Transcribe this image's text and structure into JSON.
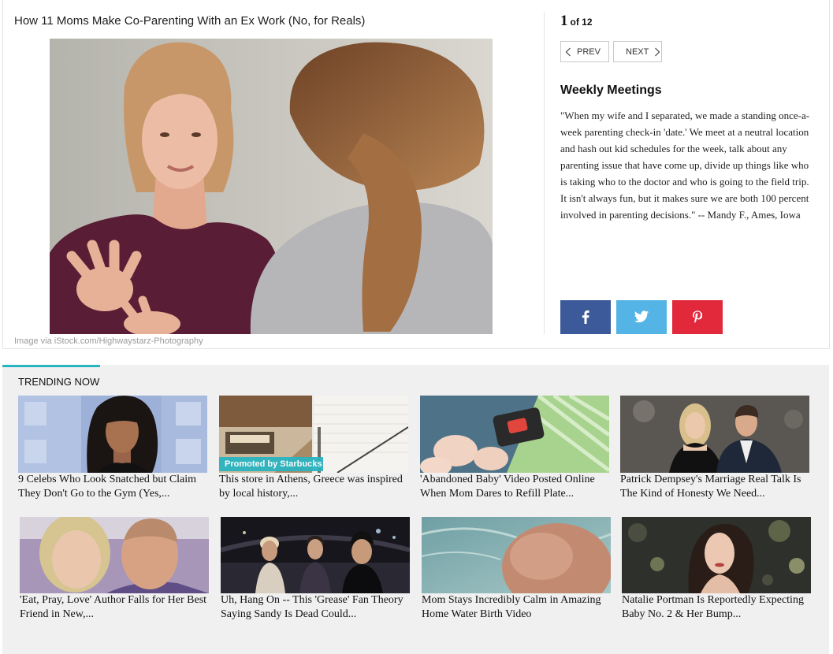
{
  "article": {
    "title": "How 11 Moms Make Co-Parenting With an Ex Work (No, for Reals)",
    "image_credit": "Image via iStock.com/Highwaystarz-Photography"
  },
  "slideshow": {
    "current": "1",
    "total_label": "of 12",
    "prev_label": "PREV",
    "prev_icon": "chevron-left-icon",
    "next_label": "NEXT",
    "next_icon": "chevron-right-icon",
    "slide_heading": "Weekly Meetings",
    "slide_body": "\"When my wife and I separated, we made a standing once-a-week parenting check-in 'date.' We meet at a neutral location and hash out kid schedules for the week, talk about any parenting issue that have come up, divide up things like who is taking who to the doctor and who is going to the field trip. It isn't always fun, but it makes sure we are both 100 percent involved in parenting decisions.\" -- Mandy F., Ames, Iowa"
  },
  "share": {
    "buttons": [
      {
        "icon": "facebook-icon",
        "color": "#3c5a99"
      },
      {
        "icon": "twitter-icon",
        "color": "#55b4e6"
      },
      {
        "icon": "pinterest-icon",
        "color": "#e2283b"
      }
    ]
  },
  "trending": {
    "heading": "TRENDING NOW",
    "accent_color": "#2ab4c1",
    "background_color": "#f0f0f0",
    "items": [
      {
        "caption": "9 Celebs Who Look Snatched but Claim They Don't Go to the Gym (Yes,..."
      },
      {
        "caption": "This store in Athens, Greece was inspired by local history,...",
        "badge": "Promoted by Starbucks"
      },
      {
        "caption": "'Abandoned Baby' Video Posted Online When Mom Dares to Refill Plate..."
      },
      {
        "caption": "Patrick Dempsey's Marriage Real Talk Is The Kind of Honesty We Need..."
      },
      {
        "caption": "'Eat, Pray, Love' Author Falls for Her Best Friend in New,..."
      },
      {
        "caption": "Uh, Hang On -- This 'Grease' Fan Theory Saying Sandy Is Dead Could..."
      },
      {
        "caption": "Mom Stays Incredibly Calm in Amazing Home Water Birth Video"
      },
      {
        "caption": "Natalie Portman Is Reportedly Expecting Baby No. 2 & Her Bump..."
      }
    ]
  }
}
